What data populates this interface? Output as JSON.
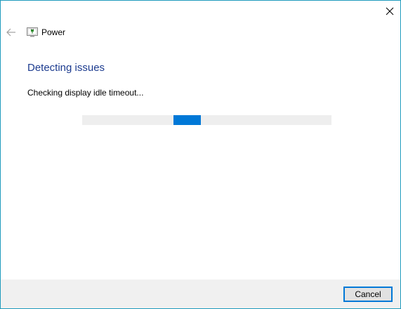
{
  "window": {
    "title": "Power"
  },
  "content": {
    "heading": "Detecting issues",
    "status": "Checking display idle timeout..."
  },
  "progress": {
    "mode": "indeterminate",
    "accent_color": "#0078d7",
    "track_color": "#eeeeee"
  },
  "footer": {
    "cancel_label": "Cancel"
  },
  "icons": {
    "close": "close-icon",
    "back": "back-arrow-icon",
    "app": "power-troubleshooter-icon"
  }
}
